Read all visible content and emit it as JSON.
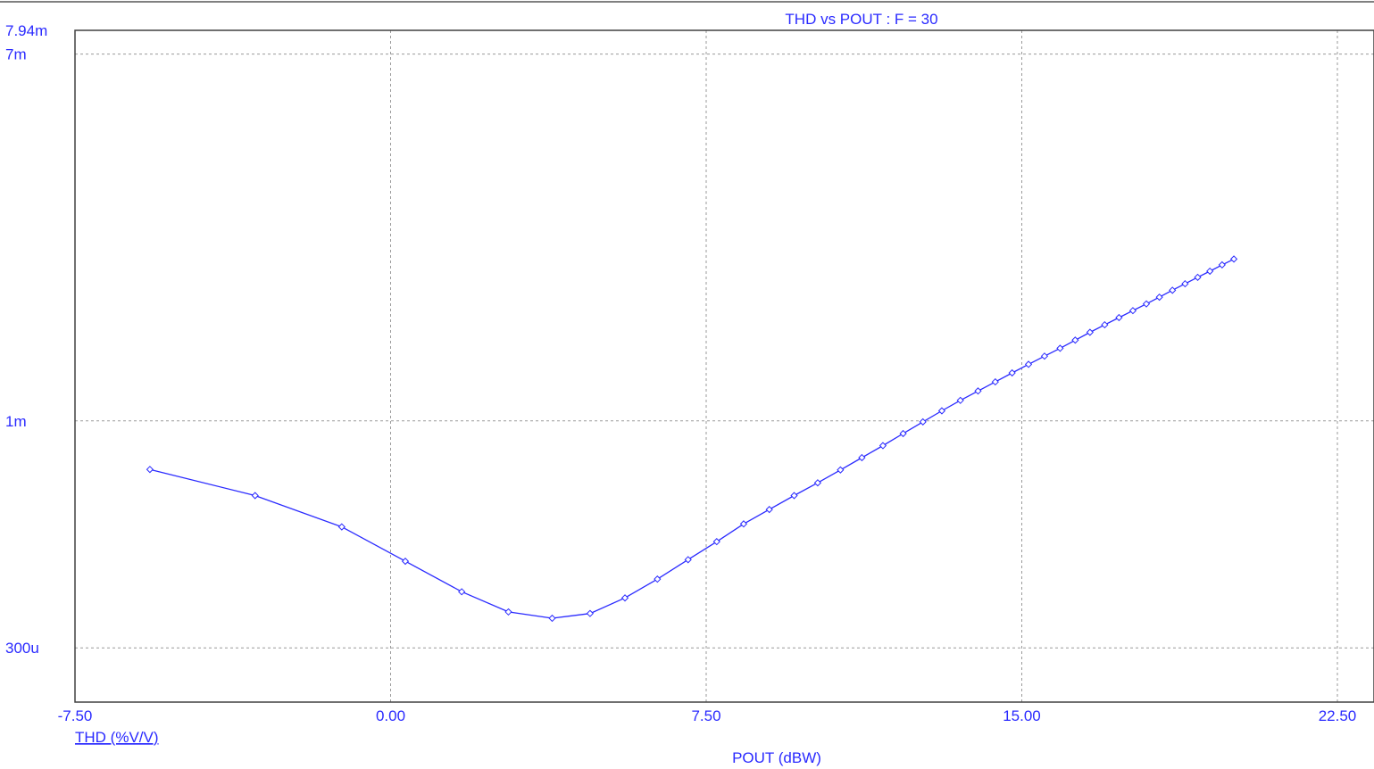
{
  "colors": {
    "series": "#2a2aff",
    "text": "#2a2aff",
    "grid": "#9a9a9a",
    "axis": "#404040",
    "background": "#ffffff"
  },
  "chart_data": {
    "type": "line",
    "title": "THD vs POUT : F = 30",
    "xlabel": "POUT (dBW)",
    "ylabel": "THD (%V/V)",
    "xlim": [
      -7.5,
      22.5
    ],
    "ylim": [
      0.000225,
      0.00794
    ],
    "yscale": "log",
    "x_tick_labels": [
      "-7.50",
      "0.00",
      "7.50",
      "15.00",
      "22.50"
    ],
    "x_ticks": [
      -7.5,
      0,
      7.5,
      15,
      22.5
    ],
    "y_tick_labels": [
      "7.94m",
      "7m",
      "1m",
      "300u"
    ],
    "y_ticks": [
      0.00794,
      0.007,
      0.001,
      0.0003
    ],
    "y_gridlines": [
      0.007,
      0.001,
      0.0003
    ],
    "grid": true,
    "markers": "diamond",
    "series": [
      {
        "name": "THD (%V/V)",
        "x": [
          -5.72,
          -3.22,
          -1.16,
          0.35,
          1.69,
          2.8,
          3.84,
          4.74,
          5.57,
          6.34,
          7.07,
          7.75,
          8.39,
          9.0,
          9.59,
          10.15,
          10.69,
          11.2,
          11.7,
          12.18,
          12.65,
          13.1,
          13.54,
          13.96,
          14.37,
          14.77,
          15.16,
          15.54,
          15.91,
          16.27,
          16.62,
          16.97,
          17.31,
          17.64,
          17.96,
          18.27,
          18.58,
          18.88,
          19.18,
          19.47,
          19.76,
          20.04
        ],
        "y": [
          0.000773,
          0.000673,
          0.00057,
          0.000475,
          0.000404,
          0.000363,
          0.000351,
          0.00036,
          0.000391,
          0.000432,
          0.000479,
          0.000527,
          0.000579,
          0.000625,
          0.000673,
          0.00072,
          0.000771,
          0.000823,
          0.000877,
          0.000935,
          0.000995,
          0.001055,
          0.001115,
          0.001172,
          0.00123,
          0.00129,
          0.00135,
          0.00141,
          0.00147,
          0.001535,
          0.0016,
          0.001665,
          0.00173,
          0.001795,
          0.00186,
          0.001928,
          0.002,
          0.00207,
          0.002142,
          0.002213,
          0.002288,
          0.00236
        ]
      }
    ]
  }
}
